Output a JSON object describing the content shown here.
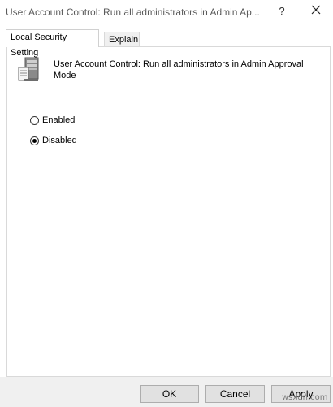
{
  "window": {
    "title": "User Account Control: Run all administrators in Admin Ap...",
    "help_label": "?",
    "close_icon": "close-icon"
  },
  "tabs": [
    {
      "label": "Local Security Setting",
      "active": true
    },
    {
      "label": "Explain",
      "active": false
    }
  ],
  "policy": {
    "icon": "policy-server-icon",
    "name": "User Account Control: Run all administrators in Admin Approval Mode"
  },
  "options": [
    {
      "label": "Enabled",
      "checked": false
    },
    {
      "label": "Disabled",
      "checked": true
    }
  ],
  "buttons": {
    "ok": "OK",
    "cancel": "Cancel",
    "apply": "Apply"
  },
  "watermark": "wsxdn.com"
}
